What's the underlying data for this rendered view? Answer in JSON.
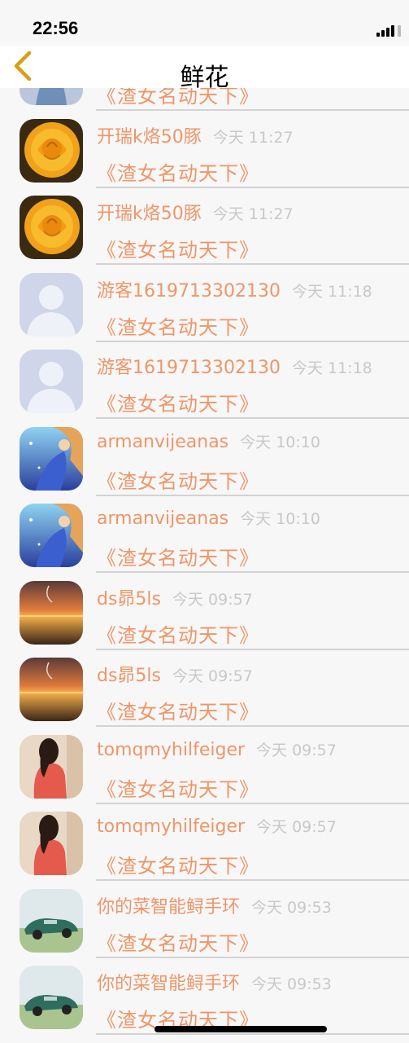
{
  "status_bar": {
    "time": "22:56"
  },
  "nav": {
    "title": "鲜花",
    "back_icon": "chevron-left-icon"
  },
  "colors": {
    "accent": "#ef9668",
    "timestamp": "#c8c8c8",
    "divider": "#d3d3d3",
    "back": "#d4a017"
  },
  "messages": [
    {
      "name": "",
      "time": "",
      "text": "《渣女名动天下》",
      "avatar": "partial"
    },
    {
      "name": "开瑞k烙50豚",
      "time": "今天 11:27",
      "text": "《渣女名动天下》",
      "avatar": "rose"
    },
    {
      "name": "开瑞k烙50豚",
      "time": "今天 11:27",
      "text": "《渣女名动天下》",
      "avatar": "rose"
    },
    {
      "name": "游客1619713302130",
      "time": "今天 11:18",
      "text": "《渣女名动天下》",
      "avatar": "default"
    },
    {
      "name": "游客1619713302130",
      "time": "今天 11:18",
      "text": "《渣女名动天下》",
      "avatar": "default"
    },
    {
      "name": "armanvijeanas",
      "time": "今天 10:10",
      "text": "《渣女名动天下》",
      "avatar": "anime"
    },
    {
      "name": "armanvijeanas",
      "time": "今天 10:10",
      "text": "《渣女名动天下》",
      "avatar": "anime"
    },
    {
      "name": "ds昴5ls",
      "time": "今天 09:57",
      "text": "《渣女名动天下》",
      "avatar": "sunset"
    },
    {
      "name": "ds昴5ls",
      "time": "今天 09:57",
      "text": "《渣女名动天下》",
      "avatar": "sunset"
    },
    {
      "name": "tomqmyhilfeiger",
      "time": "今天 09:57",
      "text": "《渣女名动天下》",
      "avatar": "girl"
    },
    {
      "name": "tomqmyhilfeiger",
      "time": "今天 09:57",
      "text": "《渣女名动天下》",
      "avatar": "girl"
    },
    {
      "name": "你的菜智能鲟手环",
      "time": "今天 09:53",
      "text": "《渣女名动天下》",
      "avatar": "car"
    },
    {
      "name": "你的菜智能鲟手环",
      "time": "今天 09:53",
      "text": "《渣女名动天下》",
      "avatar": "car"
    }
  ]
}
